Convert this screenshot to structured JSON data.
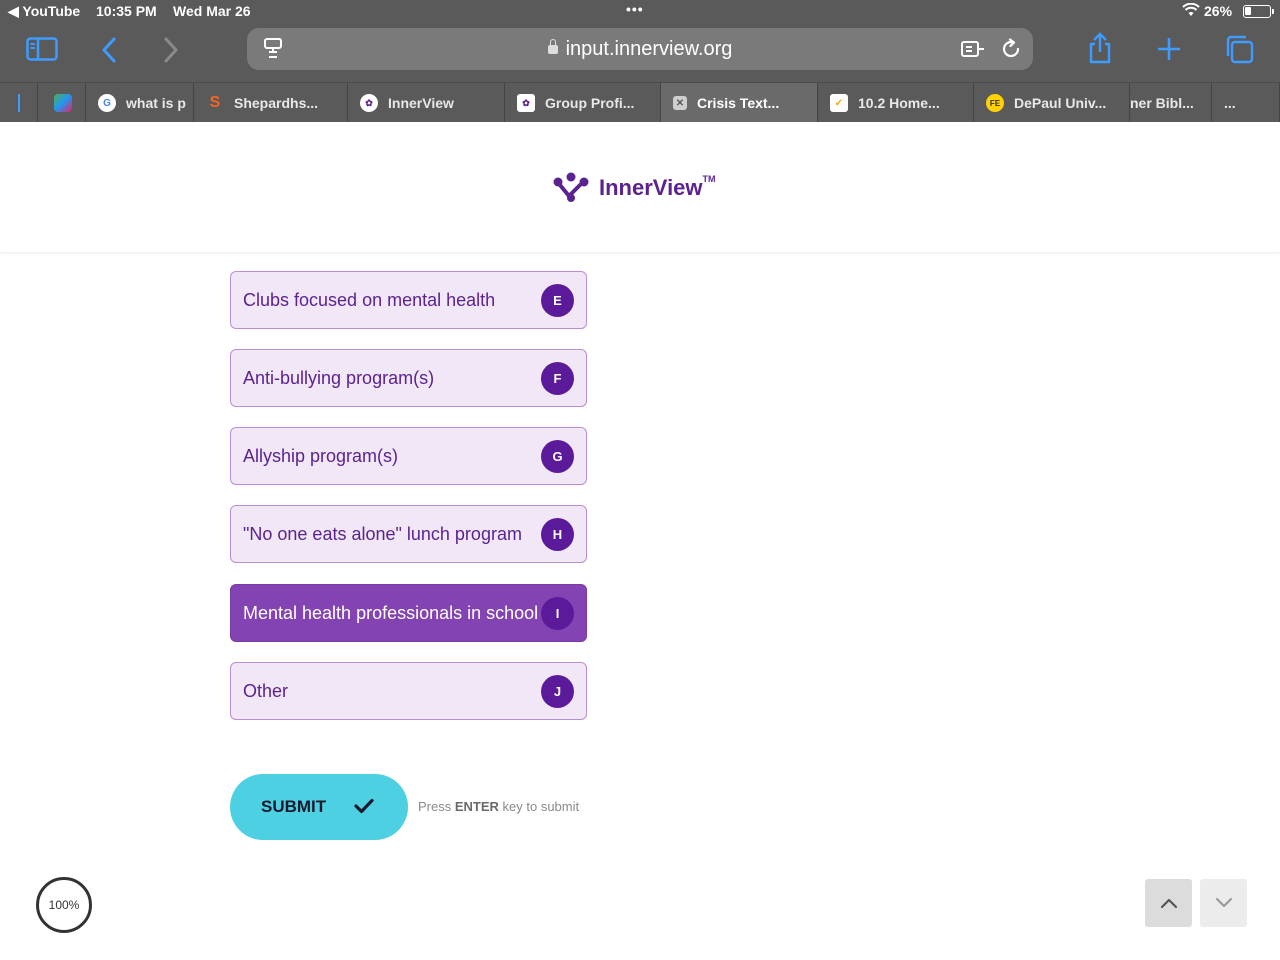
{
  "status_bar": {
    "back_app": "◀ YouTube",
    "time": "10:35 PM",
    "date": "Wed Mar 26",
    "battery_percent": "26%"
  },
  "browser": {
    "url": "input.innerview.org",
    "tabs": [
      {
        "label": "what is p",
        "icon": "google-icon"
      },
      {
        "label": "Shepardhs...",
        "icon": "s-logo-icon"
      },
      {
        "label": "InnerView",
        "icon": "innerview-icon"
      },
      {
        "label": "Group Profi...",
        "icon": "innerview-icon"
      },
      {
        "label": "Crisis Text...",
        "icon": "close-icon",
        "active": true
      },
      {
        "label": "10.2 Home...",
        "icon": "check-icon"
      },
      {
        "label": "DePaul Univ...",
        "icon": "depaul-icon"
      },
      {
        "label": "ner Bibl...",
        "icon": ""
      },
      {
        "label": "...",
        "icon": ""
      }
    ]
  },
  "header": {
    "brand": "InnerView",
    "trademark": "TM"
  },
  "options": [
    {
      "label": "Clubs focused on mental health",
      "key": "E",
      "selected": false
    },
    {
      "label": "Anti-bullying program(s)",
      "key": "F",
      "selected": false
    },
    {
      "label": "Allyship program(s)",
      "key": "G",
      "selected": false
    },
    {
      "label": "\"No one eats alone\" lunch program",
      "key": "H",
      "selected": false
    },
    {
      "label": "Mental health professionals in school",
      "key": "I",
      "selected": true
    },
    {
      "label": "Other",
      "key": "J",
      "selected": false
    }
  ],
  "submit": {
    "label": "SUBMIT",
    "hint_prefix": "Press ",
    "hint_key": "ENTER",
    "hint_suffix": " key to submit"
  },
  "progress": {
    "label": "100%",
    "value": 1.0
  },
  "colors": {
    "brand_purple": "#5b2390",
    "option_bg": "#f1e7f6",
    "selected_bg": "#8443b3",
    "submit_bg": "#4dd0e1"
  }
}
